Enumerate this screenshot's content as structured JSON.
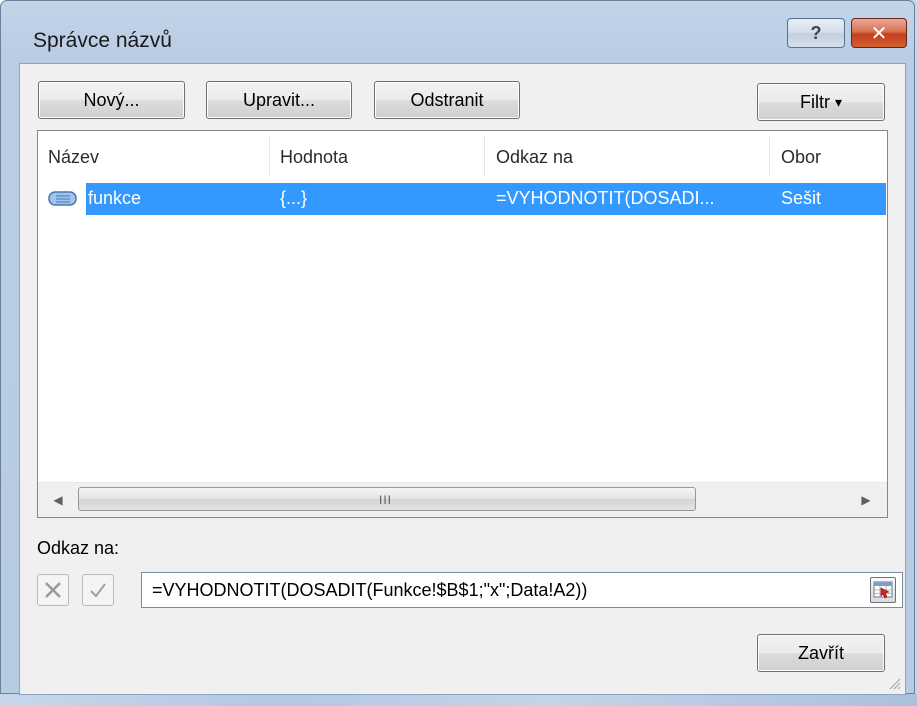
{
  "window": {
    "title": "Správce názvů",
    "help_label": "?",
    "close_label": "✕"
  },
  "toolbar": {
    "new_label": "Nový...",
    "edit_label": "Upravit...",
    "delete_label": "Odstranit",
    "filter_label": "Filtr",
    "filter_arrow": "▾"
  },
  "list": {
    "columns": [
      "Název",
      "Hodnota",
      "Odkaz na",
      "Obor"
    ],
    "rows": [
      {
        "name": "funkce",
        "value": "{...}",
        "refers_to": "=VYHODNOTIT(DOSADI...",
        "scope": "Sešit",
        "selected": true,
        "icon": "named-range-icon"
      }
    ],
    "scroll_left": "◀",
    "scroll_right": "▶",
    "scroll_grip": "III"
  },
  "refers_to": {
    "label": "Odkaz na:",
    "value": "=VYHODNOTIT(DOSADIT(Funkce!$B$1;\"x\";Data!A2))"
  },
  "footer": {
    "close_label": "Zavřít"
  },
  "colors": {
    "selection": "#3399ff",
    "title_bar": "#b9cce4",
    "close_button": "#c2401e"
  }
}
